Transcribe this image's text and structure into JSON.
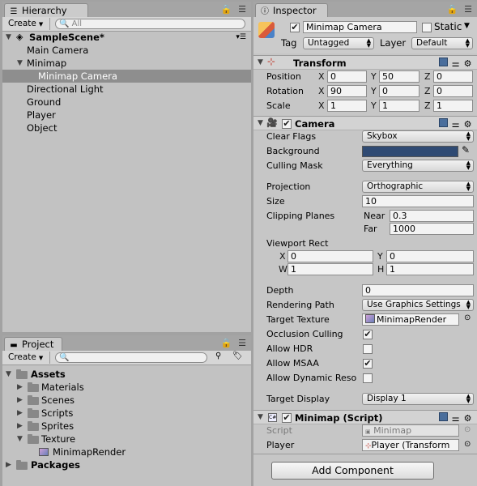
{
  "hierarchy": {
    "tab_label": "Hierarchy",
    "create_label": "Create",
    "search_placeholder": "All",
    "scene_name": "SampleScene*",
    "items": [
      {
        "label": "Main Camera"
      },
      {
        "label": "Minimap"
      },
      {
        "label": "Minimap Camera"
      },
      {
        "label": "Directional Light"
      },
      {
        "label": "Ground"
      },
      {
        "label": "Player"
      },
      {
        "label": "Object"
      }
    ]
  },
  "project": {
    "tab_label": "Project",
    "create_label": "Create",
    "tree": [
      {
        "label": "Assets"
      },
      {
        "label": "Materials"
      },
      {
        "label": "Scenes"
      },
      {
        "label": "Scripts"
      },
      {
        "label": "Sprites"
      },
      {
        "label": "Texture"
      },
      {
        "label": "MinimapRender"
      },
      {
        "label": "Packages"
      }
    ]
  },
  "inspector": {
    "tab_label": "Inspector",
    "object_name": "Minimap Camera",
    "static_label": "Static",
    "tag_label": "Tag",
    "tag_value": "Untagged",
    "layer_label": "Layer",
    "layer_value": "Default",
    "transform": {
      "title": "Transform",
      "position_label": "Position",
      "rotation_label": "Rotation",
      "scale_label": "Scale",
      "position": {
        "x": "0",
        "y": "50",
        "z": "0"
      },
      "rotation": {
        "x": "90",
        "y": "0",
        "z": "0"
      },
      "scale": {
        "x": "1",
        "y": "1",
        "z": "1"
      }
    },
    "camera": {
      "title": "Camera",
      "clear_flags_label": "Clear Flags",
      "clear_flags_value": "Skybox",
      "background_label": "Background",
      "background_color": "#2f4a73",
      "culling_mask_label": "Culling Mask",
      "culling_mask_value": "Everything",
      "projection_label": "Projection",
      "projection_value": "Orthographic",
      "size_label": "Size",
      "size_value": "10",
      "clipping_planes_label": "Clipping Planes",
      "near_label": "Near",
      "near_value": "0.3",
      "far_label": "Far",
      "far_value": "1000",
      "viewport_label": "Viewport Rect",
      "vp_x": "0",
      "vp_y": "0",
      "vp_w": "1",
      "vp_h": "1",
      "depth_label": "Depth",
      "depth_value": "0",
      "rendering_path_label": "Rendering Path",
      "rendering_path_value": "Use Graphics Settings",
      "target_texture_label": "Target Texture",
      "target_texture_value": "MinimapRender",
      "occlusion_label": "Occlusion Culling",
      "occlusion_checked": true,
      "hdr_label": "Allow HDR",
      "hdr_checked": false,
      "msaa_label": "Allow MSAA",
      "msaa_checked": true,
      "dynres_label": "Allow Dynamic Reso",
      "dynres_checked": false,
      "target_display_label": "Target Display",
      "target_display_value": "Display 1"
    },
    "minimap_script": {
      "title": "Minimap (Script)",
      "script_label": "Script",
      "script_value": "Minimap",
      "player_label": "Player",
      "player_value": "Player (Transform"
    },
    "add_component_label": "Add Component"
  },
  "letters": {
    "x": "X",
    "y": "Y",
    "z": "Z",
    "w": "W",
    "h": "H"
  },
  "colors": {
    "selection": "#8e8e8e",
    "panel": "#c2c2c2",
    "background_swatch": "#2f4a73"
  }
}
